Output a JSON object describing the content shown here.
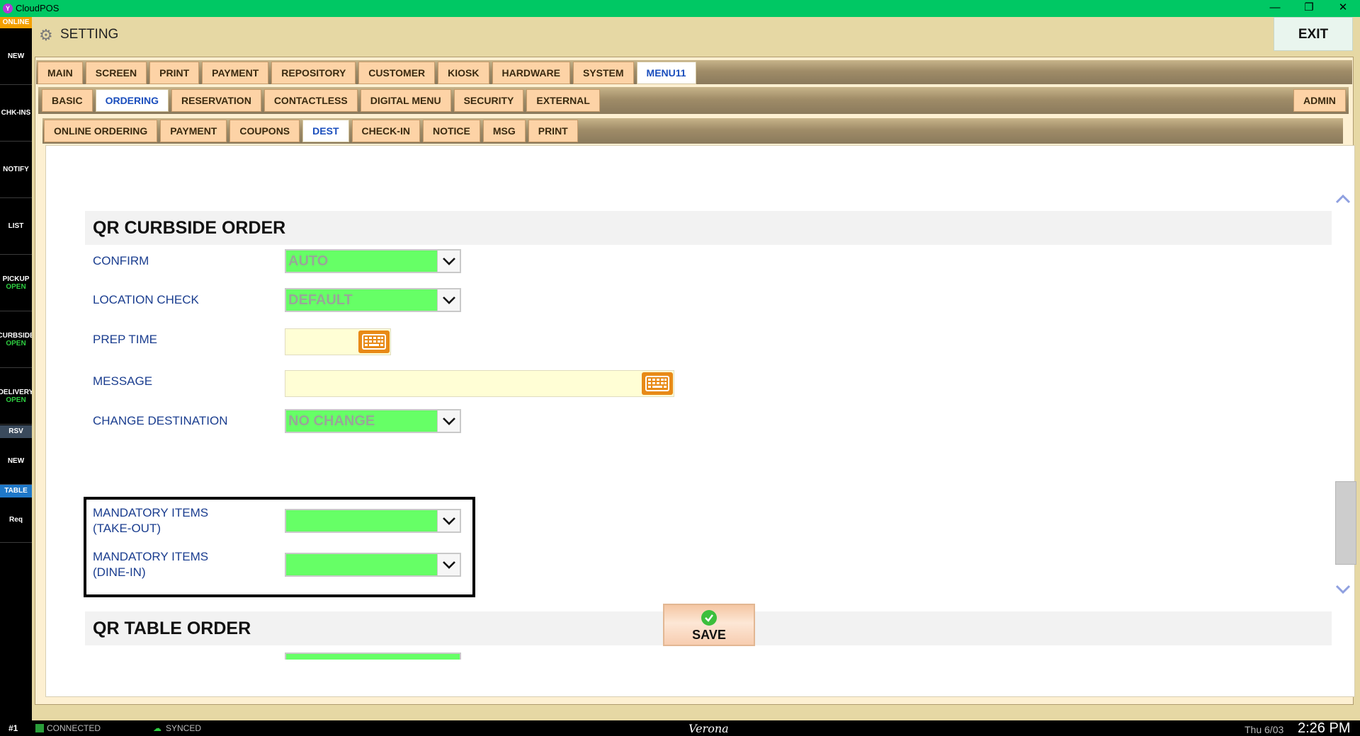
{
  "titlebar": {
    "app_name": "CloudPOS",
    "app_icon": "Y",
    "minimize": "—",
    "restore": "❐",
    "close": "✕"
  },
  "sidebar": {
    "online": "ONLINE",
    "items": [
      {
        "label": "NEW",
        "sub": ""
      },
      {
        "label": "CHK-INS",
        "sub": ""
      },
      {
        "label": "NOTIFY",
        "sub": ""
      },
      {
        "label": "LIST",
        "sub": ""
      },
      {
        "label": "PICKUP",
        "sub": "OPEN"
      },
      {
        "label": "CURBSIDE",
        "sub": "OPEN"
      },
      {
        "label": "DELIVERY",
        "sub": "OPEN"
      }
    ],
    "rsv_badge": "RSV",
    "rsv_new": "NEW",
    "table_badge": "TABLE",
    "req": "Req"
  },
  "header": {
    "title": "SETTING",
    "exit_label": "EXIT"
  },
  "tabs_main": [
    "MAIN",
    "SCREEN",
    "PRINT",
    "PAYMENT",
    "REPOSITORY",
    "CUSTOMER",
    "KIOSK",
    "HARDWARE",
    "SYSTEM",
    "MENU11"
  ],
  "tabs_sub": [
    "BASIC",
    "ORDERING",
    "RESERVATION",
    "CONTACTLESS",
    "DIGITAL MENU",
    "SECURITY",
    "EXTERNAL"
  ],
  "tab_admin": "ADMIN",
  "tabs_third": [
    "ONLINE ORDERING",
    "PAYMENT",
    "COUPONS",
    "DEST",
    "CHECK-IN",
    "NOTICE",
    "MSG",
    "PRINT"
  ],
  "form": {
    "section_curbside": "QR CURBSIDE ORDER",
    "confirm_label": "CONFIRM",
    "confirm_value": "AUTO",
    "location_label": "LOCATION CHECK",
    "location_value": "DEFAULT",
    "prep_label": "PREP TIME",
    "prep_value": "",
    "message_label": "MESSAGE",
    "message_value": "",
    "change_dest_label": "CHANGE DESTINATION",
    "change_dest_value": "NO CHANGE",
    "mandatory_takeout_line1": "MANDATORY ITEMS",
    "mandatory_takeout_line2": "(TAKE-OUT)",
    "mandatory_takeout_value": "",
    "mandatory_dinein_line1": "MANDATORY ITEMS",
    "mandatory_dinein_line2": "(DINE-IN)",
    "mandatory_dinein_value": "",
    "section_table": "QR TABLE ORDER"
  },
  "save_label": "SAVE",
  "statusbar": {
    "station": "#1",
    "connected": "CONNECTED",
    "synced": "SYNCED",
    "store": "Verona",
    "date": "Thu 6/03",
    "time": "2:26 PM"
  },
  "colors": {
    "accent_green": "#00c864",
    "select_green": "#66ff66",
    "tab_orange": "#fdd3a6",
    "label_blue": "#1a3d8f",
    "keyboard_orange": "#e88a17"
  },
  "icons": {
    "gear": "gear-icon",
    "keyboard": "keyboard-icon",
    "chevron": "chevron-down-icon",
    "check": "check-circle-icon"
  }
}
